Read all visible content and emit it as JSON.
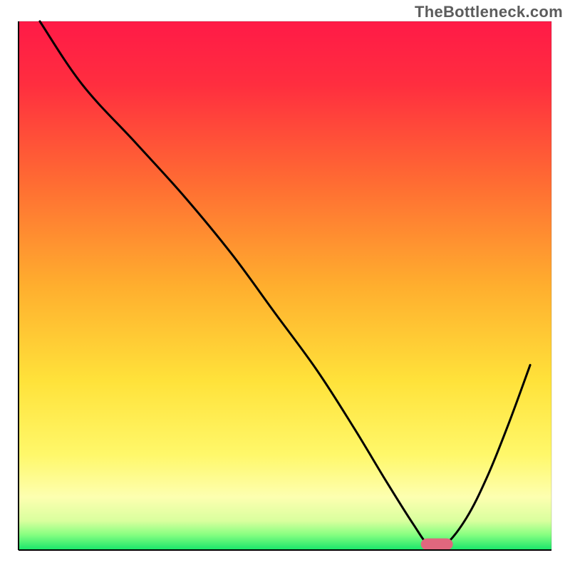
{
  "watermark": "TheBottleneck.com",
  "chart_data": {
    "type": "line",
    "title": "",
    "xlabel": "",
    "ylabel": "",
    "xlim": [
      0,
      100
    ],
    "ylim": [
      0,
      100
    ],
    "background_gradient": {
      "stops": [
        {
          "offset": 0.0,
          "color": "#ff1a47"
        },
        {
          "offset": 0.12,
          "color": "#ff2e3f"
        },
        {
          "offset": 0.3,
          "color": "#ff6a33"
        },
        {
          "offset": 0.5,
          "color": "#ffae2e"
        },
        {
          "offset": 0.68,
          "color": "#ffe23a"
        },
        {
          "offset": 0.82,
          "color": "#fff86a"
        },
        {
          "offset": 0.9,
          "color": "#fdffb0"
        },
        {
          "offset": 0.945,
          "color": "#d9ff9e"
        },
        {
          "offset": 0.97,
          "color": "#8aff82"
        },
        {
          "offset": 1.0,
          "color": "#17e66a"
        }
      ]
    },
    "series": [
      {
        "name": "bottleneck-curve",
        "color": "#000000",
        "stroke_width": 3,
        "x": [
          4,
          12,
          22,
          31,
          40,
          48,
          56,
          63,
          69,
          74,
          77,
          80,
          84,
          88,
          92,
          96
        ],
        "values": [
          100,
          88,
          77,
          67,
          56,
          45,
          34,
          23,
          13,
          5,
          1,
          1,
          6,
          14,
          24,
          35
        ]
      }
    ],
    "optimum_marker": {
      "x_center": 78.5,
      "width": 6,
      "y": 0,
      "height": 2.2,
      "color": "#e0677e",
      "radius": 1.2
    },
    "axes": {
      "show_ticks": false,
      "show_grid": false,
      "frame_color": "#000000",
      "frame_width": 2
    }
  }
}
